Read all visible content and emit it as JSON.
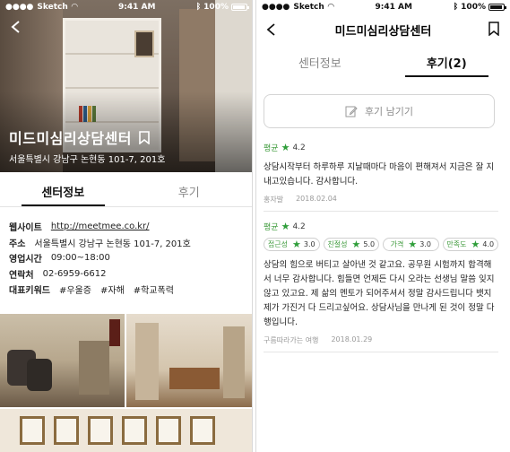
{
  "status": {
    "carrier": "Sketch",
    "time": "9:41 AM",
    "battery": "100%"
  },
  "left": {
    "title": "미드미심리상담센터",
    "address": "서울특별시 강남구 논현동 101-7, 201호",
    "tabs": [
      {
        "label": "센터정보"
      },
      {
        "label": "후기"
      }
    ],
    "info": {
      "website": {
        "key": "웹사이트",
        "value": "http://meetmee.co.kr/"
      },
      "address": {
        "key": "주소",
        "value": "서울특별시 강남구 논현동 101-7, 201호"
      },
      "hours": {
        "key": "영업시간",
        "value": "09:00~18:00"
      },
      "phone": {
        "key": "연락처",
        "value": "02-6959-6612"
      },
      "keywords": {
        "key": "대표키워드",
        "tags": [
          "#우울증",
          "#자해",
          "#학교폭력"
        ]
      }
    }
  },
  "right": {
    "title": "미드미심리상담센터",
    "tabs": [
      {
        "label": "센터정보"
      },
      {
        "label": "후기(2)"
      }
    ],
    "write_button": "후기 남기기",
    "reviews": [
      {
        "rating_label": "평균",
        "rating": "4.2",
        "text": "상담시작부터 하루하루 지날때마다 마음이 편해져서 지금은 잘 지내고있습니다. 감사합니다.",
        "author": "홍자발",
        "date": "2018.02.04"
      },
      {
        "rating_label": "평균",
        "rating": "4.2",
        "chips": [
          {
            "label": "접근성",
            "value": "3.0"
          },
          {
            "label": "친절성",
            "value": "5.0"
          },
          {
            "label": "가격",
            "value": "3.0"
          },
          {
            "label": "만족도",
            "value": "4.0"
          }
        ],
        "text": "상담의 힘으로 버티고 살아낸 것 같고요. 공무원 시험까지 합격해서 너무 감사합니다. 힘들면 언제든 다시 오라는 선생님 말씀 잊지 않고 있고요. 제 삶의 멘토가 되어주셔서 정말 감사드립니다 뱃지 제가 가진거 다 드리고싶어요. 상담사님을 만나게 된 것이 정말 다행입니다.",
        "author": "구름따라가는 여행",
        "date": "2018.01.29"
      }
    ]
  },
  "colors": {
    "accent_green": "#2f9e3a",
    "text": "#222222",
    "muted": "#999999"
  }
}
